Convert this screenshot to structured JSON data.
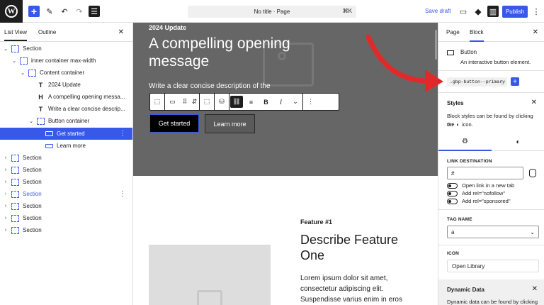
{
  "topbar": {
    "title": "No title · Page",
    "shortcut": "⌘K",
    "save_draft": "Save draft",
    "publish": "Publish"
  },
  "left_panel": {
    "tab_list_view": "List View",
    "tab_outline": "Outline",
    "close": "✕",
    "rows": [
      {
        "label": "Section"
      },
      {
        "label": "inner container max-width"
      },
      {
        "label": "Content container"
      },
      {
        "label": "2024 Update"
      },
      {
        "label": "A compelling opening messa..."
      },
      {
        "label": "Write a clear concise descrip..."
      },
      {
        "label": "Button container"
      },
      {
        "label": "Get started"
      },
      {
        "label": "Learn more"
      },
      {
        "label": "Section"
      },
      {
        "label": "Section"
      },
      {
        "label": "Section"
      },
      {
        "label": "Section"
      },
      {
        "label": "Section"
      },
      {
        "label": "Section"
      },
      {
        "label": "Section"
      }
    ]
  },
  "canvas": {
    "hero_year": "2024 Update",
    "hero_heading": "A compelling opening message",
    "hero_desc": "Write a clear concise description of the",
    "btn_primary": "Get started",
    "btn_secondary": "Learn more",
    "feature_label": "Feature #1",
    "feature_heading": "Describe Feature One",
    "feature_body": "Lorem ipsum dolor sit amet, consectetur adipiscing elit. Suspendisse varius enim in eros"
  },
  "right_panel": {
    "tab_page": "Page",
    "tab_block": "Block",
    "block_name": "Button",
    "block_desc": "An interactive button element.",
    "class_name": ".gbp-button--primary",
    "styles_title": "Styles",
    "styles_text_1": "Block styles can be found by clicking on",
    "styles_text_2": "the",
    "styles_text_3": "icon.",
    "link_destination_label": "LINK DESTINATION",
    "link_value": "#",
    "toggle_new_tab": "Open link in a new tab",
    "toggle_nofollow": "Add rel=\"nofollow\"",
    "toggle_sponsored": "Add rel=\"sponsored\"",
    "tag_name_label": "TAG NAME",
    "tag_value": "a",
    "icon_label": "ICON",
    "open_library": "Open Library",
    "dynamic_title": "Dynamic Data",
    "dynamic_text": "Dynamic data can be found by clicking"
  },
  "colors": {
    "accent": "#3858e9",
    "hero_bg": "#666666",
    "arrow": "#e02a2a"
  }
}
